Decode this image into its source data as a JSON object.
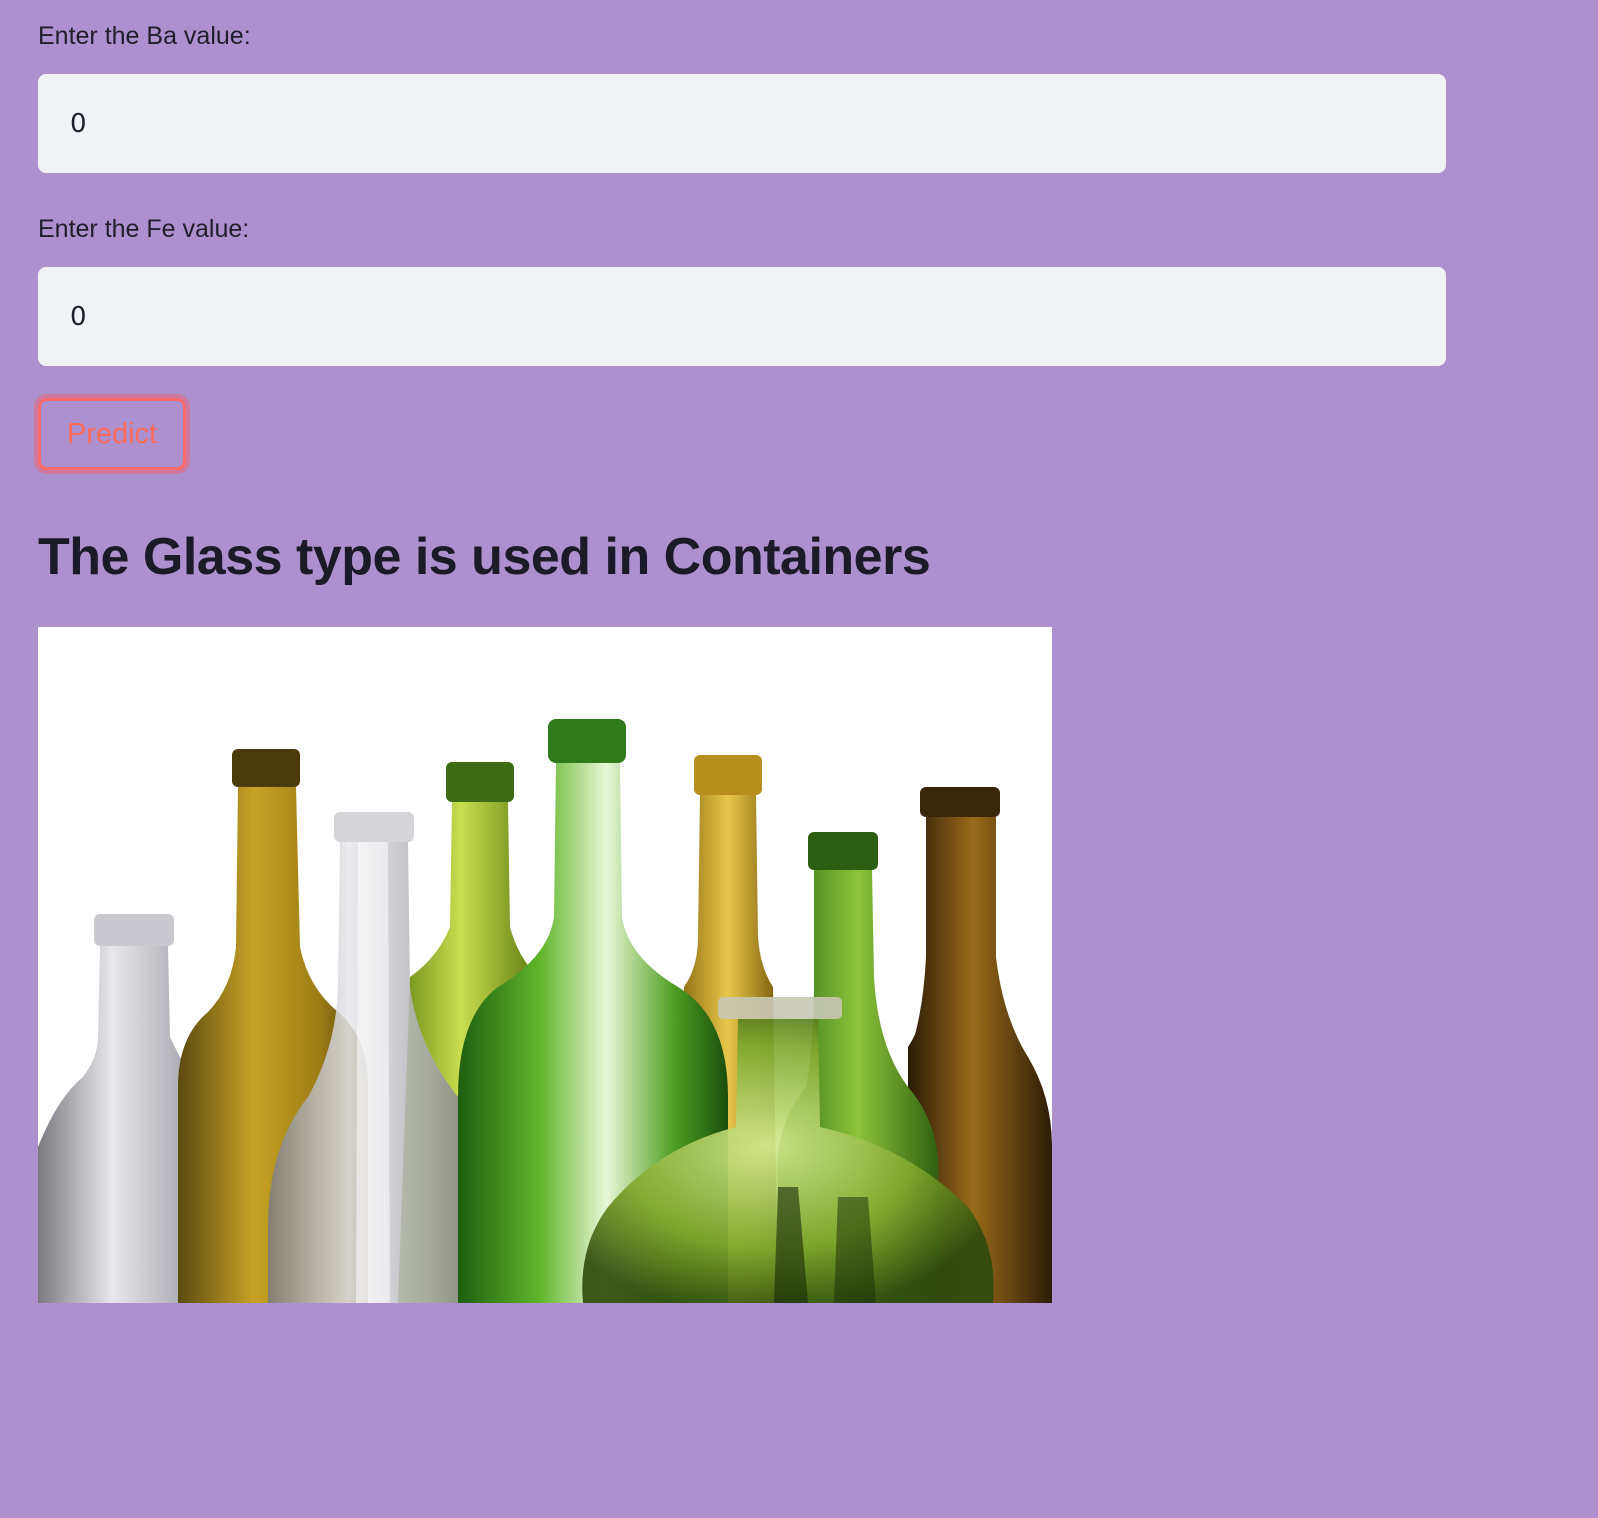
{
  "form": {
    "ba": {
      "label": "Enter the Ba value:",
      "value": "0"
    },
    "fe": {
      "label": "Enter the Fe value:",
      "value": "0"
    },
    "predict_label": "Predict"
  },
  "result": {
    "heading": "The Glass type is used in Containers"
  },
  "colors": {
    "background": "#ad91ce",
    "input_bg": "#f0f2f6",
    "button_accent": "#ff6b5a"
  }
}
